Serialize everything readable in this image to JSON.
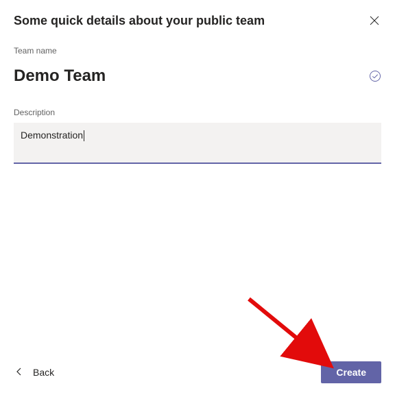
{
  "dialog": {
    "title": "Some quick details about your public team",
    "close_icon": "close"
  },
  "fields": {
    "team_name_label": "Team name",
    "team_name_value": "Demo Team",
    "check_icon": "check-circle",
    "description_label": "Description",
    "description_value": "Demonstration"
  },
  "footer": {
    "back_label": "Back",
    "create_label": "Create"
  },
  "colors": {
    "accent": "#6264a7"
  }
}
